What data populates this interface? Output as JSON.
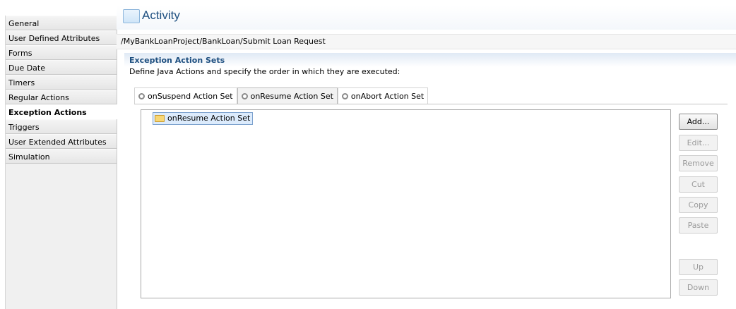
{
  "sidebar": {
    "items": [
      {
        "label": "General"
      },
      {
        "label": "User Defined Attributes"
      },
      {
        "label": "Forms"
      },
      {
        "label": "Due Date"
      },
      {
        "label": "Timers"
      },
      {
        "label": "Regular Actions"
      },
      {
        "label": "Exception Actions",
        "active": true
      },
      {
        "label": "Triggers"
      },
      {
        "label": "User Extended Attributes"
      },
      {
        "label": "Simulation"
      }
    ]
  },
  "header": {
    "title": "Activity"
  },
  "path": "/MyBankLoanProject/BankLoan/Submit Loan Request",
  "section": {
    "title": "Exception Action Sets",
    "description": "Define Java Actions and specify the order in which they are executed:"
  },
  "tabs": [
    {
      "label": "onSuspend Action Set"
    },
    {
      "label": "onResume Action Set",
      "active": true
    },
    {
      "label": "onAbort Action Set"
    }
  ],
  "tree": {
    "selected_item": "onResume Action Set"
  },
  "buttons": {
    "add": "Add...",
    "edit": "Edit...",
    "remove": "Remove",
    "cut": "Cut",
    "copy": "Copy",
    "paste": "Paste",
    "up": "Up",
    "down": "Down"
  }
}
